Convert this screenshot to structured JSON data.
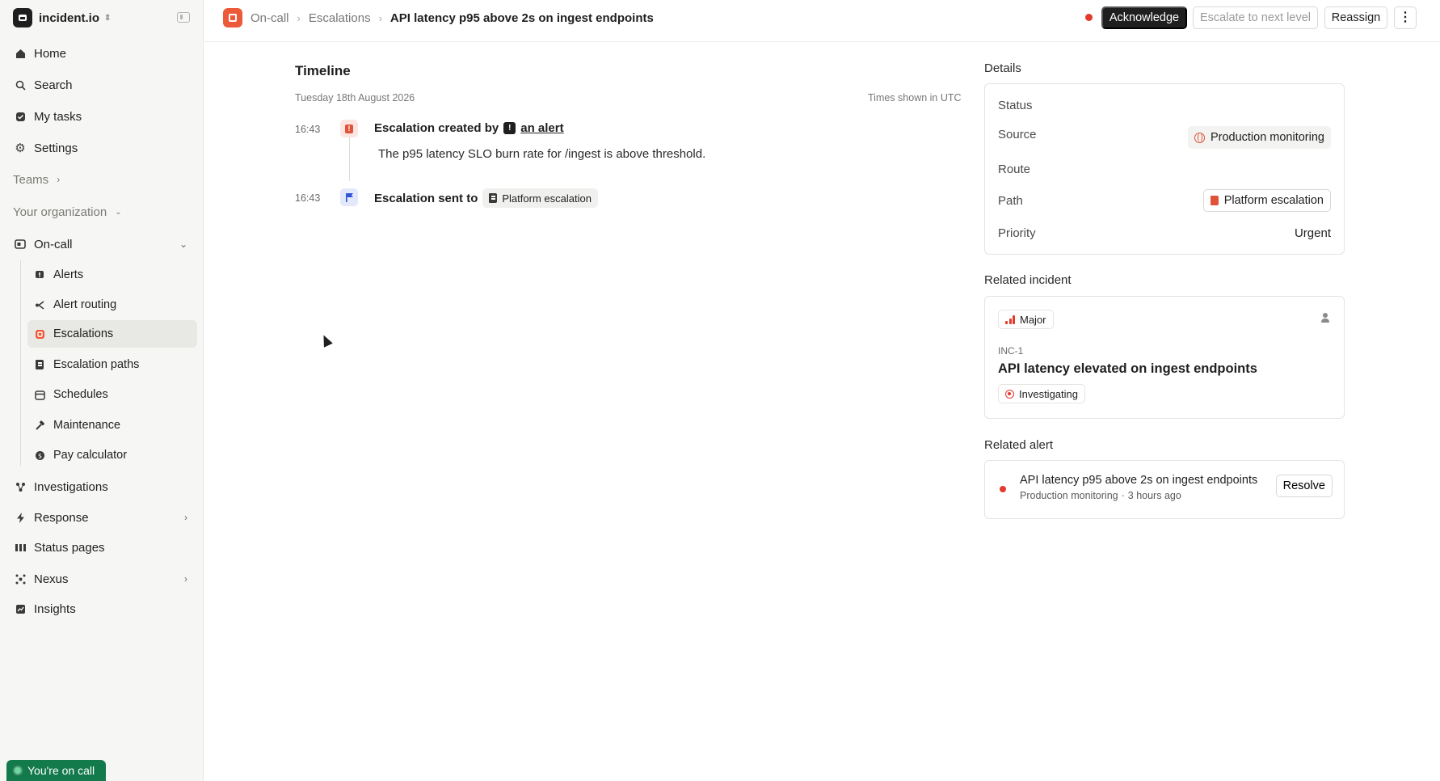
{
  "org": {
    "name": "incident.io"
  },
  "sidebar": {
    "items": [
      {
        "label": "Home",
        "icon": "home-icon"
      },
      {
        "label": "Search",
        "icon": "search-icon"
      },
      {
        "label": "My tasks",
        "icon": "tasks-icon"
      },
      {
        "label": "Settings",
        "icon": "gear-icon"
      }
    ],
    "teams_label": "Teams",
    "org_label": "Your organization",
    "oncall_label": "On-call",
    "oncall_items": [
      {
        "label": "Alerts",
        "icon": "alert-icon"
      },
      {
        "label": "Alert routing",
        "icon": "routing-icon"
      },
      {
        "label": "Escalations",
        "icon": "escalation-icon"
      },
      {
        "label": "Escalation paths",
        "icon": "book-icon"
      },
      {
        "label": "Schedules",
        "icon": "calendar-icon"
      },
      {
        "label": "Maintenance",
        "icon": "hammer-icon"
      },
      {
        "label": "Pay calculator",
        "icon": "dollar-icon"
      }
    ],
    "bottom_items": [
      {
        "label": "Investigations",
        "icon": "network-icon"
      },
      {
        "label": "Response",
        "icon": "bolt-icon"
      },
      {
        "label": "Status pages",
        "icon": "bars-icon"
      },
      {
        "label": "Nexus",
        "icon": "nexus-icon"
      },
      {
        "label": "Insights",
        "icon": "chart-icon"
      }
    ],
    "on_call_badge": "You're on call"
  },
  "header": {
    "breadcrumb": [
      "On-call",
      "Escalations"
    ],
    "title": "API latency p95 above 2s on ingest endpoints",
    "acknowledge_label": "Acknowledge",
    "escalate_label": "Escalate to next level",
    "reassign_label": "Reassign"
  },
  "timeline": {
    "heading": "Timeline",
    "date": "Tuesday 18th August 2026",
    "timezone_note": "Times shown in UTC",
    "events": [
      {
        "time": "16:43",
        "title_prefix": "Escalation created by",
        "link": "an alert",
        "description": "The p95 latency SLO burn rate for /ingest is above threshold."
      },
      {
        "time": "16:43",
        "title_prefix": "Escalation sent to",
        "chip": "Platform escalation"
      }
    ]
  },
  "details": {
    "heading": "Details",
    "status_label": "Status",
    "source_label": "Source",
    "source_value": "Production monitoring",
    "route_label": "Route",
    "path_label": "Path",
    "path_value": "Platform escalation",
    "priority_label": "Priority",
    "priority_value": "Urgent"
  },
  "related_incident": {
    "heading": "Related incident",
    "severity": "Major",
    "id": "INC-1",
    "title": "API latency elevated on ingest endpoints",
    "status": "Investigating"
  },
  "related_alert": {
    "heading": "Related alert",
    "title": "API latency p95 above 2s on ingest endpoints",
    "source": "Production monitoring",
    "separator": "·",
    "age": "3 hours ago",
    "resolve_label": "Resolve"
  },
  "colors": {
    "brand_orange": "#ed5a3a",
    "alert_red": "#e23b2e",
    "on_call_green": "#137a4b"
  }
}
